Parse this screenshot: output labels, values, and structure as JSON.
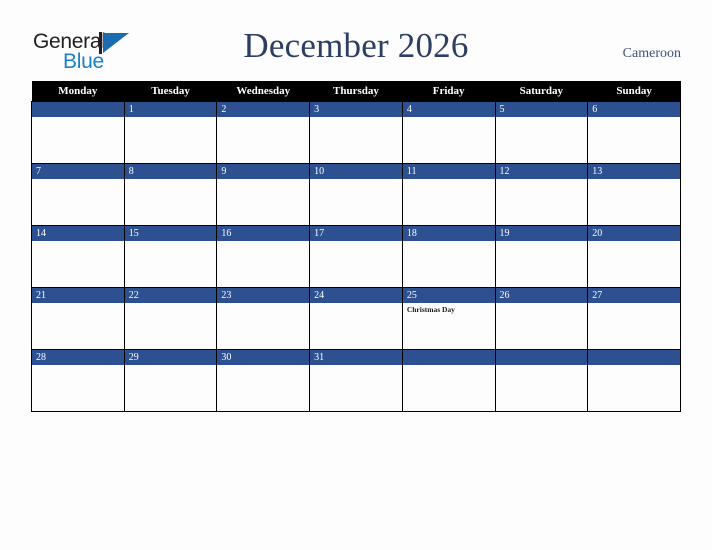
{
  "brand": {
    "word_one": "General",
    "word_two": "Blue",
    "mark": "triangle-logo-mark",
    "accent_dark": "#231f20",
    "accent_blue": "#1b81c8",
    "mark_blue": "#1b6cb0"
  },
  "header": {
    "title": "December 2026",
    "country": "Cameroon",
    "title_color": "#2c3e63",
    "country_color": "#3c5378"
  },
  "calendar": {
    "header_bg": "#000000",
    "daynum_bg": "#2d5190",
    "weekdays": [
      "Monday",
      "Tuesday",
      "Wednesday",
      "Thursday",
      "Friday",
      "Saturday",
      "Sunday"
    ],
    "weeks": [
      [
        {
          "day": "",
          "events": []
        },
        {
          "day": "1",
          "events": []
        },
        {
          "day": "2",
          "events": []
        },
        {
          "day": "3",
          "events": []
        },
        {
          "day": "4",
          "events": []
        },
        {
          "day": "5",
          "events": []
        },
        {
          "day": "6",
          "events": []
        }
      ],
      [
        {
          "day": "7",
          "events": []
        },
        {
          "day": "8",
          "events": []
        },
        {
          "day": "9",
          "events": []
        },
        {
          "day": "10",
          "events": []
        },
        {
          "day": "11",
          "events": []
        },
        {
          "day": "12",
          "events": []
        },
        {
          "day": "13",
          "events": []
        }
      ],
      [
        {
          "day": "14",
          "events": []
        },
        {
          "day": "15",
          "events": []
        },
        {
          "day": "16",
          "events": []
        },
        {
          "day": "17",
          "events": []
        },
        {
          "day": "18",
          "events": []
        },
        {
          "day": "19",
          "events": []
        },
        {
          "day": "20",
          "events": []
        }
      ],
      [
        {
          "day": "21",
          "events": []
        },
        {
          "day": "22",
          "events": []
        },
        {
          "day": "23",
          "events": []
        },
        {
          "day": "24",
          "events": []
        },
        {
          "day": "25",
          "events": [
            "Christmas Day"
          ]
        },
        {
          "day": "26",
          "events": []
        },
        {
          "day": "27",
          "events": []
        }
      ],
      [
        {
          "day": "28",
          "events": []
        },
        {
          "day": "29",
          "events": []
        },
        {
          "day": "30",
          "events": []
        },
        {
          "day": "31",
          "events": []
        },
        {
          "day": "",
          "events": []
        },
        {
          "day": "",
          "events": []
        },
        {
          "day": "",
          "events": []
        }
      ]
    ]
  }
}
